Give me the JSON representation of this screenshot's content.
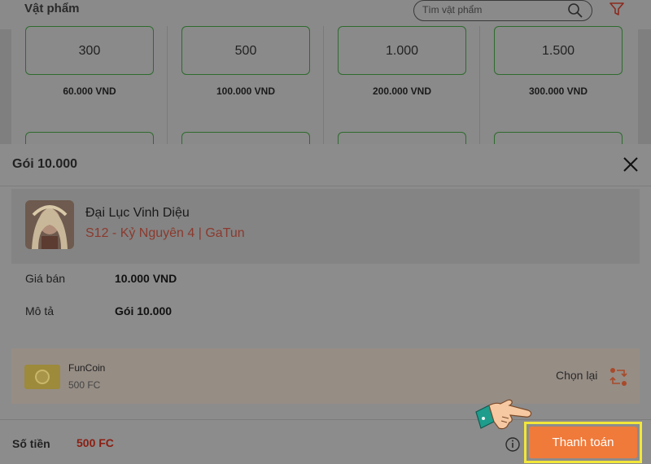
{
  "background": {
    "title": "Vật phẩm",
    "search_placeholder": "Tìm vật phẩm",
    "icons": [
      "search-icon",
      "filter-icon"
    ],
    "packages": [
      {
        "amount": "300",
        "price": "60.000 VND"
      },
      {
        "amount": "500",
        "price": "100.000 VND"
      },
      {
        "amount": "1.000",
        "price": "200.000 VND"
      },
      {
        "amount": "1.500",
        "price": "300.000 VND"
      }
    ]
  },
  "modal": {
    "title": "Gói 10.000",
    "game": {
      "name": "Đại Lục Vinh Diệu",
      "server": "S12 - Kỷ Nguyên 4 | GaTun"
    },
    "details": [
      {
        "label": "Giá bán",
        "value": "10.000 VND"
      },
      {
        "label": "Mô tả",
        "value": "Gói 10.000"
      }
    ],
    "payment": {
      "method": "FunCoin",
      "balance": "500 FC",
      "reselect_label": "Chọn lại"
    },
    "footer": {
      "total_label": "Số tiền",
      "total_value": "500 FC",
      "pay_button": "Thanh toán"
    }
  },
  "colors": {
    "accent": "#f07a3a",
    "highlight": "#f2e63a",
    "price_red": "#8b1e12",
    "server_red": "#8b3a2e",
    "pack_border": "#2e6b2e"
  }
}
